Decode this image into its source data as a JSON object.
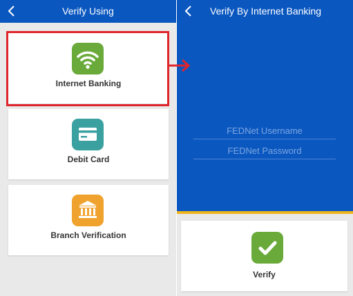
{
  "left_screen": {
    "title": "Verify Using",
    "options": [
      {
        "label": "Internet Banking",
        "icon": "wifi-icon",
        "color": "#6aaa3a"
      },
      {
        "label": "Debit Card",
        "icon": "card-icon",
        "color": "#3aa0a0"
      },
      {
        "label": "Branch Verification",
        "icon": "bank-icon",
        "color": "#f0a22e"
      }
    ]
  },
  "right_screen": {
    "title": "Verify By Internet Banking",
    "username_placeholder": "FEDNet Username",
    "password_placeholder": "FEDNet Password",
    "verify_label": "Verify",
    "verify_icon": "checkmark-icon",
    "verify_color": "#6aaa3a"
  },
  "colors": {
    "appbar": "#0a57c0",
    "accent_strip": "#f0b41c",
    "highlight": "#e0242c"
  }
}
